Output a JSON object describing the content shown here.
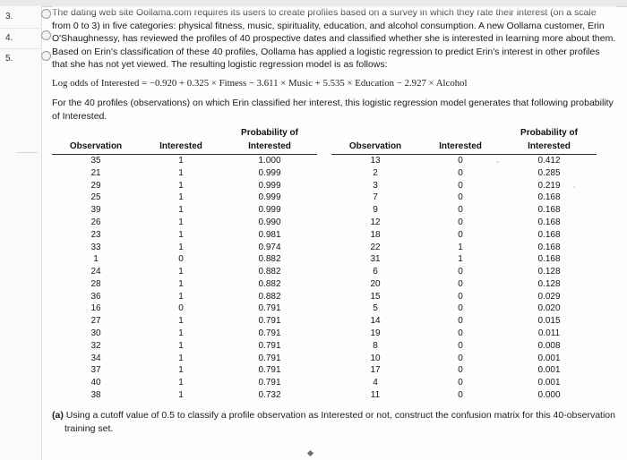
{
  "gutter": {
    "numbers": [
      "3.",
      "4.",
      "5."
    ]
  },
  "body": {
    "para1": "The dating web site Oollama.com requires its users to create profiles based on a survey in which they rate their interest (on a scale from 0 to 3) in five categories: physical fitness, music, spirituality, education, and alcohol consumption. A new Oollama customer, Erin O'Shaughnessy, has reviewed the profiles of 40 prospective dates and classified whether she is interested in learning more about them.",
    "para2": "Based on Erin's classification of these 40 profiles, Oollama has applied a logistic regression to predict Erin's interest in other profiles that she has not yet viewed. The resulting logistic regression model is as follows:",
    "formula": "Log odds of Interested = −0.920 + 0.325 × Fitness − 3.611 × Music + 5.535 × Education − 2.927 × Alcohol",
    "para3": "For the 40 profiles (observations) on which Erin classified her interest, this logistic regression model generates that following probability of Interested.",
    "question_a_label": "(a)",
    "question_a_text": "Using a cutoff value of 0.5 to classify a profile observation as Interested or not, construct the confusion matrix for this 40-observation",
    "question_a_text2": "training set."
  },
  "table": {
    "headers": {
      "observation": "Observation",
      "interested": "Interested",
      "probability_line1": "Probability of",
      "probability_line2": "Interested"
    },
    "left_rows": [
      {
        "observation": "35",
        "interested": "1",
        "probability": "1.000"
      },
      {
        "observation": "21",
        "interested": "1",
        "probability": "0.999"
      },
      {
        "observation": "29",
        "interested": "1",
        "probability": "0.999"
      },
      {
        "observation": "25",
        "interested": "1",
        "probability": "0.999"
      },
      {
        "observation": "39",
        "interested": "1",
        "probability": "0.999"
      },
      {
        "observation": "26",
        "interested": "1",
        "probability": "0.990"
      },
      {
        "observation": "23",
        "interested": "1",
        "probability": "0.981"
      },
      {
        "observation": "33",
        "interested": "1",
        "probability": "0.974"
      },
      {
        "observation": "1",
        "interested": "0",
        "probability": "0.882"
      },
      {
        "observation": "24",
        "interested": "1",
        "probability": "0.882"
      },
      {
        "observation": "28",
        "interested": "1",
        "probability": "0.882"
      },
      {
        "observation": "36",
        "interested": "1",
        "probability": "0.882"
      },
      {
        "observation": "16",
        "interested": "0",
        "probability": "0.791"
      },
      {
        "observation": "27",
        "interested": "1",
        "probability": "0.791"
      },
      {
        "observation": "30",
        "interested": "1",
        "probability": "0.791"
      },
      {
        "observation": "32",
        "interested": "1",
        "probability": "0.791"
      },
      {
        "observation": "34",
        "interested": "1",
        "probability": "0.791"
      },
      {
        "observation": "37",
        "interested": "1",
        "probability": "0.791"
      },
      {
        "observation": "40",
        "interested": "1",
        "probability": "0.791"
      },
      {
        "observation": "38",
        "interested": "1",
        "probability": "0.732"
      }
    ],
    "right_rows": [
      {
        "observation": "13",
        "interested": "0",
        "probability": "0.412"
      },
      {
        "observation": "2",
        "interested": "0",
        "probability": "0.285"
      },
      {
        "observation": "3",
        "interested": "0",
        "probability": "0.219"
      },
      {
        "observation": "7",
        "interested": "0",
        "probability": "0.168"
      },
      {
        "observation": "9",
        "interested": "0",
        "probability": "0.168"
      },
      {
        "observation": "12",
        "interested": "0",
        "probability": "0.168"
      },
      {
        "observation": "18",
        "interested": "0",
        "probability": "0.168"
      },
      {
        "observation": "22",
        "interested": "1",
        "probability": "0.168"
      },
      {
        "observation": "31",
        "interested": "1",
        "probability": "0.168"
      },
      {
        "observation": "6",
        "interested": "0",
        "probability": "0.128"
      },
      {
        "observation": "20",
        "interested": "0",
        "probability": "0.128"
      },
      {
        "observation": "15",
        "interested": "0",
        "probability": "0.029"
      },
      {
        "observation": "5",
        "interested": "0",
        "probability": "0.020"
      },
      {
        "observation": "14",
        "interested": "0",
        "probability": "0.015"
      },
      {
        "observation": "19",
        "interested": "0",
        "probability": "0.011"
      },
      {
        "observation": "8",
        "interested": "0",
        "probability": "0.008"
      },
      {
        "observation": "10",
        "interested": "0",
        "probability": "0.001"
      },
      {
        "observation": "17",
        "interested": "0",
        "probability": "0.001"
      },
      {
        "observation": "4",
        "interested": "0",
        "probability": "0.001"
      },
      {
        "observation": "11",
        "interested": "0",
        "probability": "0.000"
      }
    ]
  }
}
